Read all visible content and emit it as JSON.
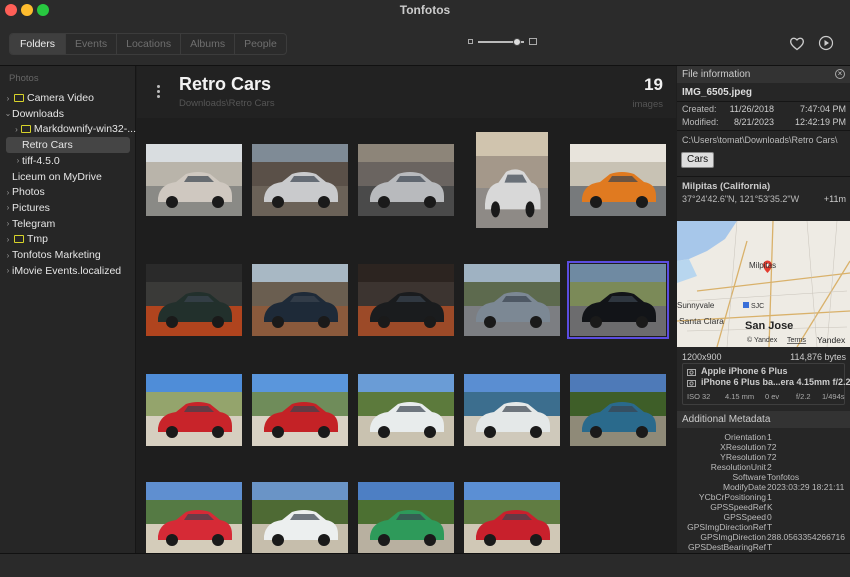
{
  "window": {
    "title": "Tonfotos"
  },
  "toolbar": {
    "tabs": [
      "Folders",
      "Events",
      "Locations",
      "Albums",
      "People"
    ],
    "active_tab": "Folders",
    "zoom_level": 0.85
  },
  "sidebar": {
    "header": "Photos",
    "items": [
      {
        "label": "Camera Video",
        "depth": 0,
        "chevron": "›",
        "icon": "folder"
      },
      {
        "label": "Downloads",
        "depth": 0,
        "chevron": "⌄",
        "icon": "grid"
      },
      {
        "label": "Markdownify-win32-...",
        "depth": 1,
        "chevron": "›",
        "icon": "folder"
      },
      {
        "label": "Retro Cars",
        "depth": 1,
        "chevron": "",
        "icon": "grid",
        "selected": true
      },
      {
        "label": "tiff-4.5.0",
        "depth": 1,
        "chevron": "›",
        "icon": "grid"
      },
      {
        "label": "Liceum on MyDrive",
        "depth": 0,
        "chevron": "",
        "icon": "grid"
      },
      {
        "label": "Photos",
        "depth": 0,
        "chevron": "›",
        "icon": "grid"
      },
      {
        "label": "Pictures",
        "depth": 0,
        "chevron": "›",
        "icon": "grid"
      },
      {
        "label": "Telegram",
        "depth": 0,
        "chevron": "›",
        "icon": "grid"
      },
      {
        "label": "Tmp",
        "depth": 0,
        "chevron": "›",
        "icon": "folder"
      },
      {
        "label": "Tonfotos Marketing",
        "depth": 0,
        "chevron": "›",
        "icon": "grid"
      },
      {
        "label": "iMovie Events.localized",
        "depth": 0,
        "chevron": "›",
        "icon": "grid"
      }
    ]
  },
  "main": {
    "title": "Retro Cars",
    "path": "Downloads\\Retro Cars",
    "count": "19",
    "count_label": "images"
  },
  "thumbnails": [
    {
      "sky": "#d9dde0",
      "ground": "#8a8a86",
      "car": "#cfc8c0",
      "bg": "#b9b4aa"
    },
    {
      "sky": "#7f8b96",
      "ground": "#6b6258",
      "car": "#c9cacc",
      "bg": "#5a5048"
    },
    {
      "sky": "#8d8579",
      "ground": "#4a4a4a",
      "car": "#b8babd",
      "bg": "#6a6460"
    },
    {
      "sky": "#d0c4ae",
      "ground": "#8e8a86",
      "car": "#d8d8d8",
      "bg": "#a4988a"
    },
    {
      "sky": "#e8e4dc",
      "ground": "#777a7c",
      "car": "#e07a20",
      "bg": "#c8c2b4"
    },
    {
      "sky": "#2a2a2a",
      "ground": "#b0441e",
      "car": "#22302c",
      "bg": "#3a3a38"
    },
    {
      "sky": "#a8b8c4",
      "ground": "#8b5a3c",
      "car": "#1e2a38",
      "bg": "#6a5e50"
    },
    {
      "sky": "#2c2420",
      "ground": "#9c4a28",
      "car": "#1a1c1e",
      "bg": "#3c3430"
    },
    {
      "sky": "#9fb2c2",
      "ground": "#7c7e82",
      "car": "#7c8894",
      "bg": "#5d6a4e"
    },
    {
      "sky": "#6f8aa2",
      "ground": "#6c6c6e",
      "car": "#121418",
      "bg": "#7b8a58",
      "selected": true
    },
    {
      "sky": "#4f8dd8",
      "ground": "#d6cfc0",
      "car": "#c8242a",
      "bg": "#94a46c"
    },
    {
      "sky": "#5a96dc",
      "ground": "#d9d2c4",
      "car": "#c42226",
      "bg": "#6f8c5a"
    },
    {
      "sky": "#6a9cd6",
      "ground": "#c9c2b0",
      "car": "#e8ecec",
      "bg": "#5c7a3c"
    },
    {
      "sky": "#5a8ed2",
      "ground": "#cfc9bb",
      "car": "#e4e8e8",
      "bg": "#3c6e8e"
    },
    {
      "sky": "#4e7ab8",
      "ground": "#8f8a78",
      "car": "#2a6a8c",
      "bg": "#3e5e28"
    },
    {
      "sky": "#5f8fd0",
      "ground": "#d4ccba",
      "car": "#d62a36",
      "bg": "#557a44"
    },
    {
      "sky": "#6a94c6",
      "ground": "#c6beac",
      "car": "#ecefef",
      "bg": "#4e6a34"
    },
    {
      "sky": "#4d7fc4",
      "ground": "#b8b0a0",
      "car": "#2e9a5a",
      "bg": "#4c7032"
    },
    {
      "sky": "#5b8fd4",
      "ground": "#d0c8b6",
      "car": "#c8202c",
      "bg": "#607c42"
    }
  ],
  "info": {
    "header": "File information",
    "filename": "IMG_6505.jpeg",
    "created_label": "Created:",
    "created_date": "11/26/2018",
    "created_time": "7:47:04 PM",
    "modified_label": "Modified:",
    "modified_date": "8/21/2023",
    "modified_time": "12:42:19 PM",
    "path": "C:\\Users\\tomat\\Downloads\\Retro Cars\\",
    "tag": "Cars",
    "location": "Milpitas (California)",
    "coords": "37°24'42.6\"N, 121°53'35.2\"W",
    "altitude": "+11m",
    "map_labels": {
      "city1": "Milpitas",
      "city2": "Sunnyvale",
      "city3": "Santa Clara",
      "city4": "San Jose",
      "airport": "SJC",
      "brand": "© Yandex",
      "terms": "Terms",
      "brand_logo": "Yandex"
    },
    "resolution": "1200x900",
    "filesize": "114,876 bytes",
    "camera_make": "Apple iPhone 6 Plus",
    "camera_lens": "iPhone 6 Plus ba...era 4.15mm f/2.2",
    "iso": "ISO 32",
    "focal": "4.15 mm",
    "ev": "0 ev",
    "aperture": "f/2.2",
    "shutter": "1/494s",
    "meta_header": "Additional Metadata",
    "metadata": [
      {
        "k": "Orientation",
        "v": "1"
      },
      {
        "k": "XResolution",
        "v": "72"
      },
      {
        "k": "YResolution",
        "v": "72"
      },
      {
        "k": "ResolutionUnit",
        "v": "2"
      },
      {
        "k": "Software",
        "v": "Tonfotos"
      },
      {
        "k": "ModifyDate",
        "v": "2023:03:29 18:21:11"
      },
      {
        "k": "YCbCrPositioning",
        "v": "1"
      },
      {
        "k": "GPSSpeedRef",
        "v": "K"
      },
      {
        "k": "GPSSpeed",
        "v": "0"
      },
      {
        "k": "GPSImgDirectionRef",
        "v": "T"
      },
      {
        "k": "GPSImgDirection",
        "v": "288.0563354266716"
      },
      {
        "k": "GPSDestBearingRef",
        "v": "T"
      }
    ]
  }
}
